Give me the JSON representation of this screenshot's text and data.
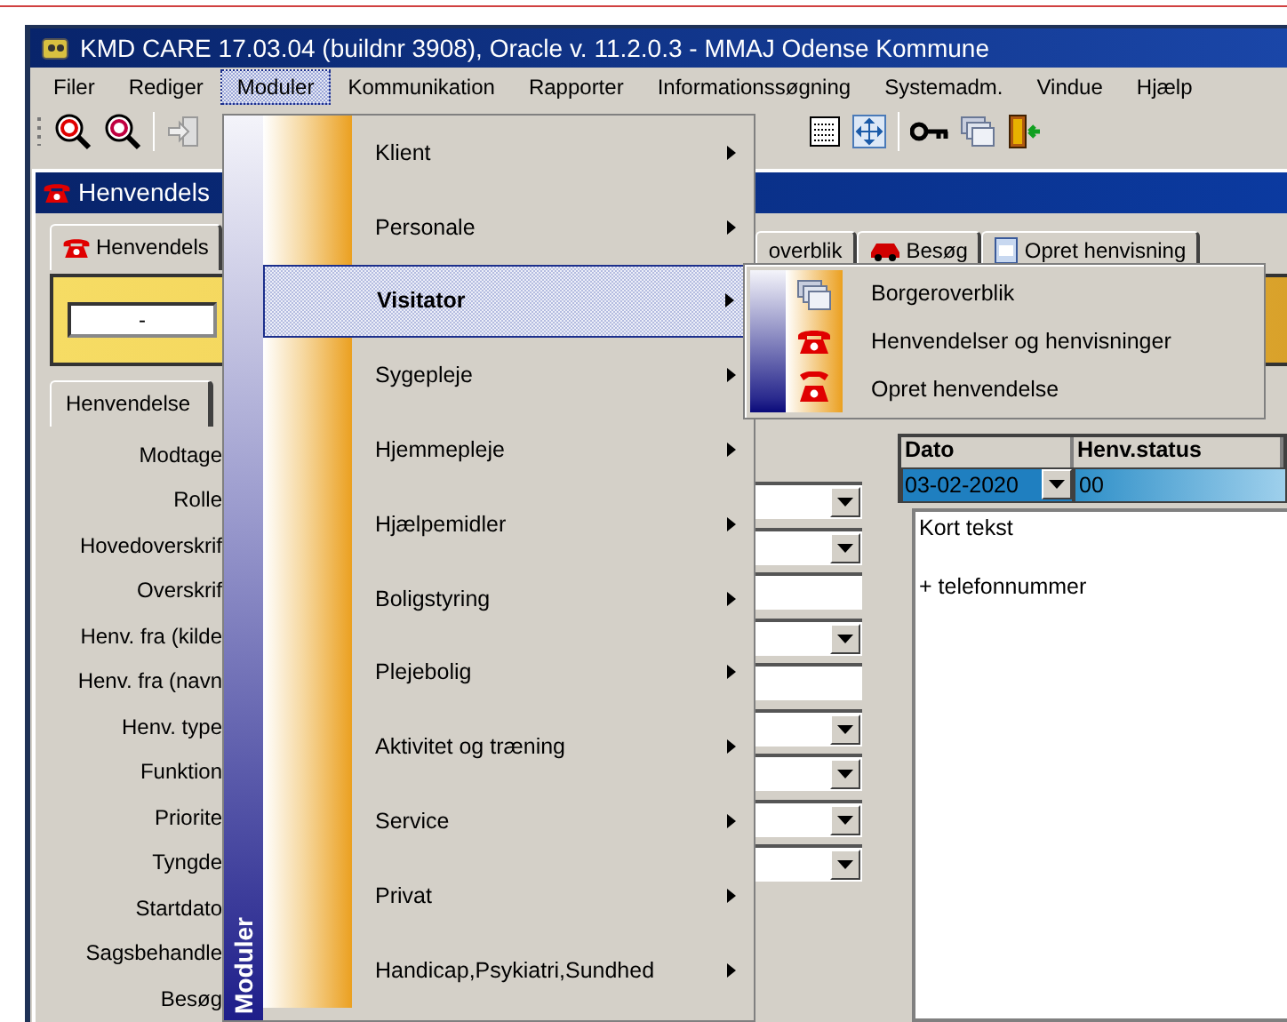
{
  "window": {
    "title": "KMD CARE  17.03.04 (buildnr 3908), Oracle v. 11.2.0.3 - MMAJ Odense Kommune"
  },
  "menu_bar": [
    {
      "label": "Filer",
      "selected": false
    },
    {
      "label": "Rediger",
      "selected": false
    },
    {
      "label": "Moduler",
      "selected": true
    },
    {
      "label": "Kommunikation",
      "selected": false
    },
    {
      "label": "Rapporter",
      "selected": false
    },
    {
      "label": "Informationssøgning",
      "selected": false
    },
    {
      "label": "Systemadm.",
      "selected": false
    },
    {
      "label": "Vindue",
      "selected": false
    },
    {
      "label": "Hjælp",
      "selected": false
    }
  ],
  "child_window": {
    "title": "Henvendels"
  },
  "tabs": [
    {
      "label": "Henvendels",
      "selected": true,
      "kind": "phone"
    },
    {
      "label": "overblik",
      "selected": false,
      "kind": "none"
    },
    {
      "label": "Besøg",
      "selected": false,
      "kind": "car"
    },
    {
      "label": "Opret henvisning",
      "selected": false,
      "kind": "form"
    }
  ],
  "code_field": {
    "value": "-"
  },
  "form_tab": {
    "label": "Henvendelse"
  },
  "labels": [
    "Modtage",
    "Rolle",
    "Hovedoverskrif",
    "Overskrif",
    "Henv. fra (kilde",
    "Henv. fra (navn",
    "Henv. type",
    "Funktion",
    "Priorite",
    "Tyngde",
    "Startdato",
    "Sagsbehandle",
    "Besøg"
  ],
  "fields": [
    {
      "kind": "none"
    },
    {
      "kind": "dropdown"
    },
    {
      "kind": "dropdown"
    },
    {
      "kind": "text"
    },
    {
      "kind": "dropdown"
    },
    {
      "kind": "text"
    },
    {
      "kind": "dropdown"
    },
    {
      "kind": "dropdown"
    },
    {
      "kind": "dropdown"
    },
    {
      "kind": "dropdown"
    }
  ],
  "grid": {
    "columns": [
      "Dato",
      "Henv.status"
    ],
    "row": {
      "date": "03-02-2020",
      "status": "00",
      "selected": true
    }
  },
  "note": {
    "lines": [
      "Kort tekst",
      "+ telefonnummer"
    ]
  },
  "menu": {
    "caption": "Moduler",
    "items": [
      {
        "label": "Klient",
        "selected": false
      },
      {
        "label": "Personale",
        "selected": false
      },
      {
        "label": "Visitator",
        "selected": true
      },
      {
        "label": "Sygepleje",
        "selected": false
      },
      {
        "label": "Hjemmepleje",
        "selected": false
      },
      {
        "label": "Hjælpemidler",
        "selected": false
      },
      {
        "label": "Boligstyring",
        "selected": false
      },
      {
        "label": "Plejebolig",
        "selected": false
      },
      {
        "label": "Aktivitet og træning",
        "selected": false
      },
      {
        "label": "Service",
        "selected": false
      },
      {
        "label": "Privat",
        "selected": false
      },
      {
        "label": "Handicap,Psykiatri,Sundhed",
        "selected": false
      }
    ]
  },
  "submenu": {
    "items": [
      {
        "label": "Borgeroverblik",
        "kind": "windows"
      },
      {
        "label": "Henvendelser og henvisninger",
        "kind": "phone"
      },
      {
        "label": "Opret henvendelse",
        "kind": "handset"
      }
    ]
  }
}
